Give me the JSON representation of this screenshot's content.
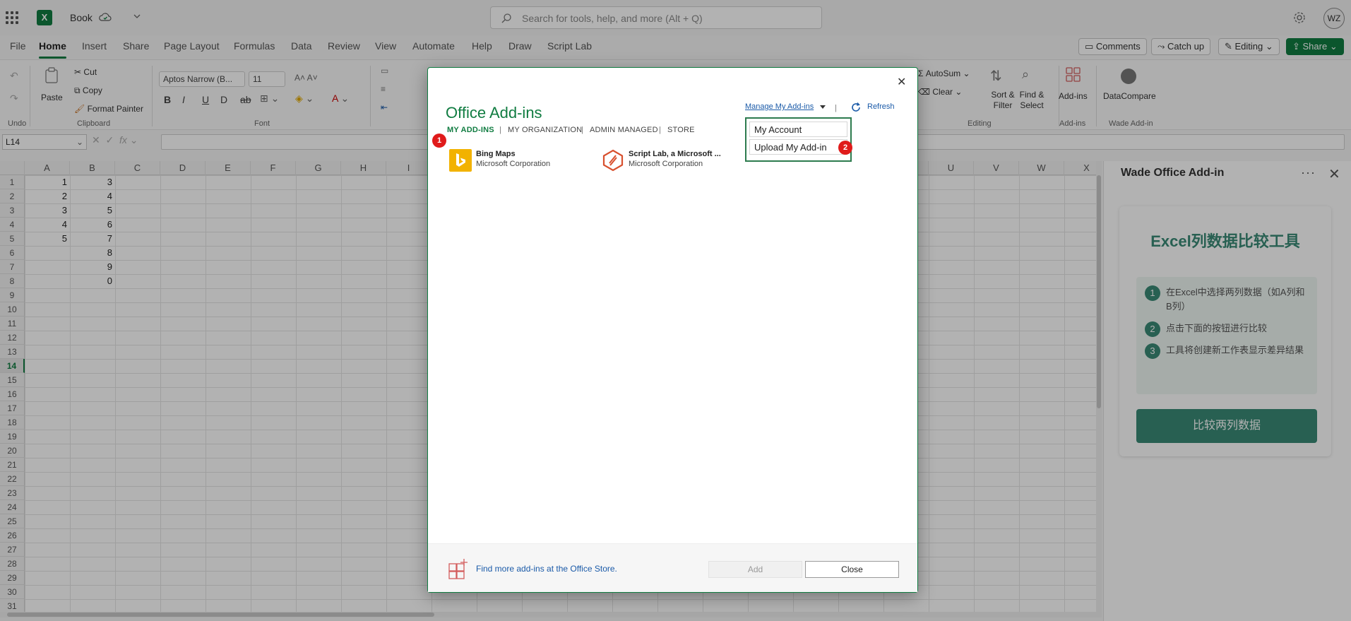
{
  "titlebar": {
    "book_name": "Book",
    "search_placeholder": "Search for tools, help, and more (Alt + Q)",
    "avatar_initials": "WZ"
  },
  "tabs": [
    "File",
    "Home",
    "Insert",
    "Share",
    "Page Layout",
    "Formulas",
    "Data",
    "Review",
    "View",
    "Automate",
    "Help",
    "Draw",
    "Script Lab"
  ],
  "active_tab": "Home",
  "right_buttons": {
    "comments": "Comments",
    "catchup": "Catch up",
    "editing": "Editing",
    "share": "Share"
  },
  "ribbon": {
    "undo_group": "Undo",
    "paste": "Paste",
    "cut": "Cut",
    "copy": "Copy",
    "format_painter": "Format Painter",
    "clipboard_group": "Clipboard",
    "font_name": "Aptos Narrow (B...",
    "font_size": "11",
    "font_group": "Font",
    "autosum": "AutoSum",
    "clear": "Clear",
    "sort_filter": "Sort & Filter",
    "find_select": "Find & Select",
    "editing_group": "Editing",
    "addins": "Add-ins",
    "addins_group": "Add-ins",
    "datacompare": "DataCompare",
    "wade_group": "Wade Add-in"
  },
  "formula_bar": {
    "name_box": "L14",
    "fx": "fx"
  },
  "grid": {
    "columns": [
      "A",
      "B",
      "C",
      "D",
      "E",
      "F",
      "G",
      "H",
      "I",
      "",
      "",
      "",
      "",
      "",
      "",
      "",
      "",
      "",
      "",
      "",
      "U",
      "V",
      "W",
      "X"
    ],
    "rows": [
      "1",
      "2",
      "3",
      "4",
      "5",
      "6",
      "7",
      "8",
      "9",
      "10",
      "11",
      "12",
      "13",
      "14",
      "15",
      "16",
      "17",
      "18",
      "19",
      "20",
      "21",
      "22",
      "23",
      "24",
      "25",
      "26",
      "27",
      "28",
      "29",
      "30",
      "31"
    ],
    "col_a": [
      "1",
      "2",
      "3",
      "4",
      "5"
    ],
    "col_b": [
      "3",
      "4",
      "5",
      "6",
      "7",
      "8",
      "9",
      "0"
    ],
    "selected_row": "14"
  },
  "taskpane": {
    "title": "Wade Office Add-in",
    "heading": "Excel列数据比较工具",
    "steps": [
      {
        "num": "1",
        "text": "在Excel中选择两列数据（如A列和B列）"
      },
      {
        "num": "2",
        "text": "点击下面的按钮进行比较"
      },
      {
        "num": "3",
        "text": "工具将创建新工作表显示差异结果"
      }
    ],
    "button": "比较两列数据",
    "accent": "#3a8a76"
  },
  "dialog": {
    "title": "Office Add-ins",
    "tabs": [
      "MY ADD-INS",
      "MY ORGANIZATION",
      "ADMIN MANAGED",
      "STORE"
    ],
    "manage_link": "Manage My Add-ins",
    "refresh": "Refresh",
    "menu": [
      "My Account",
      "Upload My Add-in"
    ],
    "addins": [
      {
        "name": "Bing Maps",
        "publisher": "Microsoft Corporation"
      },
      {
        "name": "Script Lab, a Microsoft ...",
        "publisher": "Microsoft Corporation"
      }
    ],
    "store_link": "Find more add-ins at the Office Store.",
    "add_button": "Add",
    "close_button": "Close",
    "badges": [
      "1",
      "2"
    ],
    "accent": "#107c41"
  }
}
